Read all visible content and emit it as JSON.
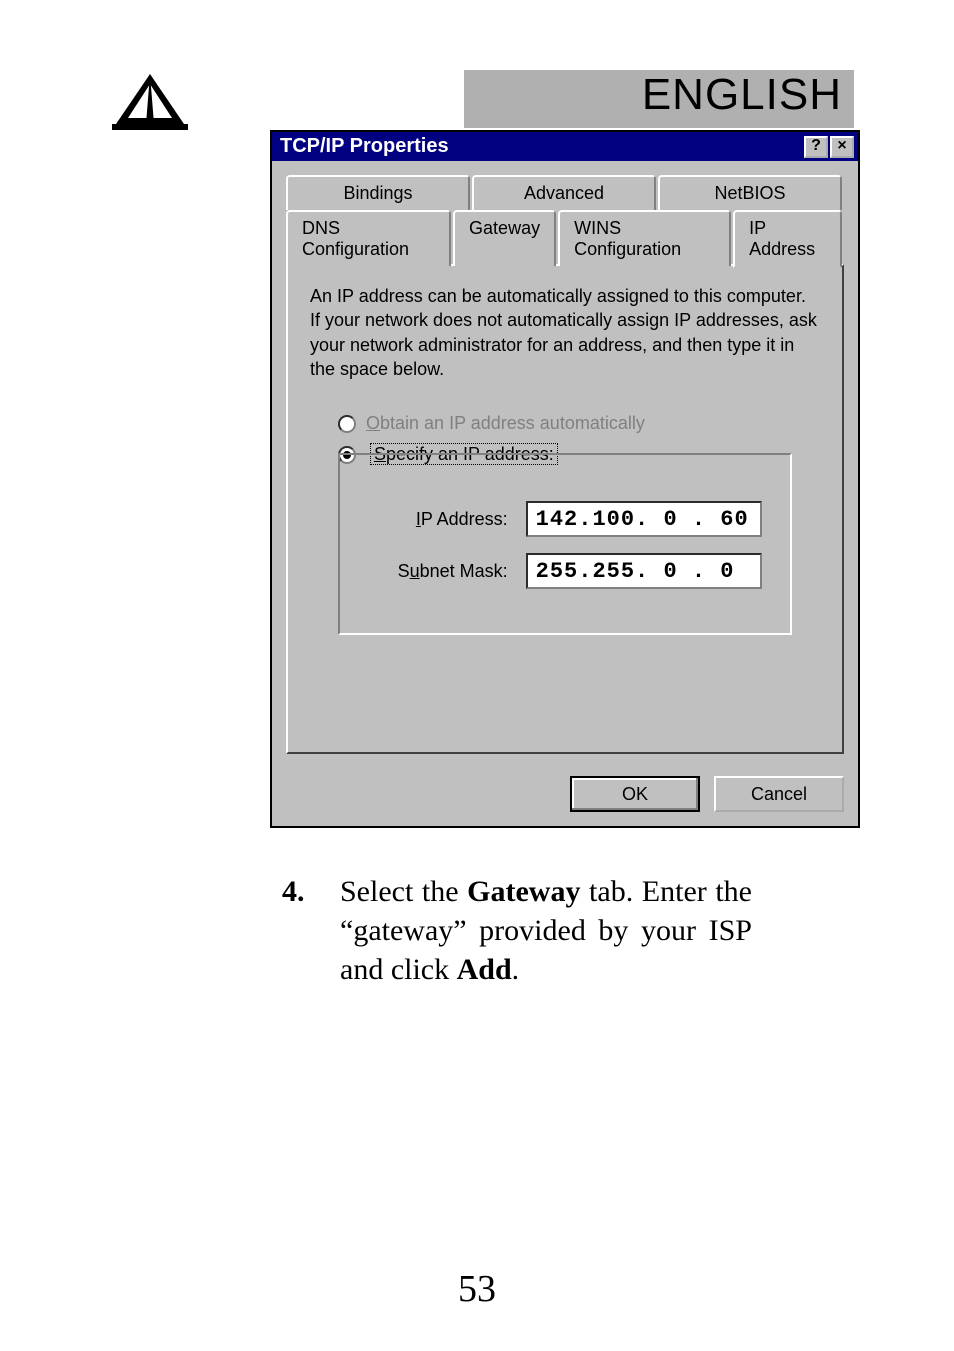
{
  "header": {
    "language_label": "ENGLISH"
  },
  "dialog": {
    "title": "TCP/IP Properties",
    "help_icon": "?",
    "close_icon": "×",
    "tabs_row1": [
      "Bindings",
      "Advanced",
      "NetBIOS"
    ],
    "tabs_row2": [
      "DNS Configuration",
      "Gateway",
      "WINS Configuration",
      "IP Address"
    ],
    "active_tab": "IP Address",
    "description": "An IP address can be automatically assigned to this computer. If your network does not automatically assign IP addresses, ask your network administrator for an address, and then type it in the space below.",
    "radio_obtain_label": "Obtain an IP address automatically",
    "radio_obtain_accesskey": "O",
    "radio_specify_label": "Specify an IP address:",
    "radio_specify_accesskey": "S",
    "selected_radio": "specify",
    "ip_label": "IP Address:",
    "ip_accesskey": "I",
    "ip_value": "142.100.  0 . 60",
    "subnet_label": "Subnet Mask:",
    "subnet_accesskey": "u",
    "subnet_value": "255.255.  0 .  0",
    "ok_label": "OK",
    "cancel_label": "Cancel"
  },
  "instruction": {
    "number": "4.",
    "text_parts": [
      "Select  the  ",
      "Gateway",
      "  tab.  Enter  the  “gateway” provided by your ISP and click ",
      "Add",
      "."
    ]
  },
  "page_number": "53"
}
